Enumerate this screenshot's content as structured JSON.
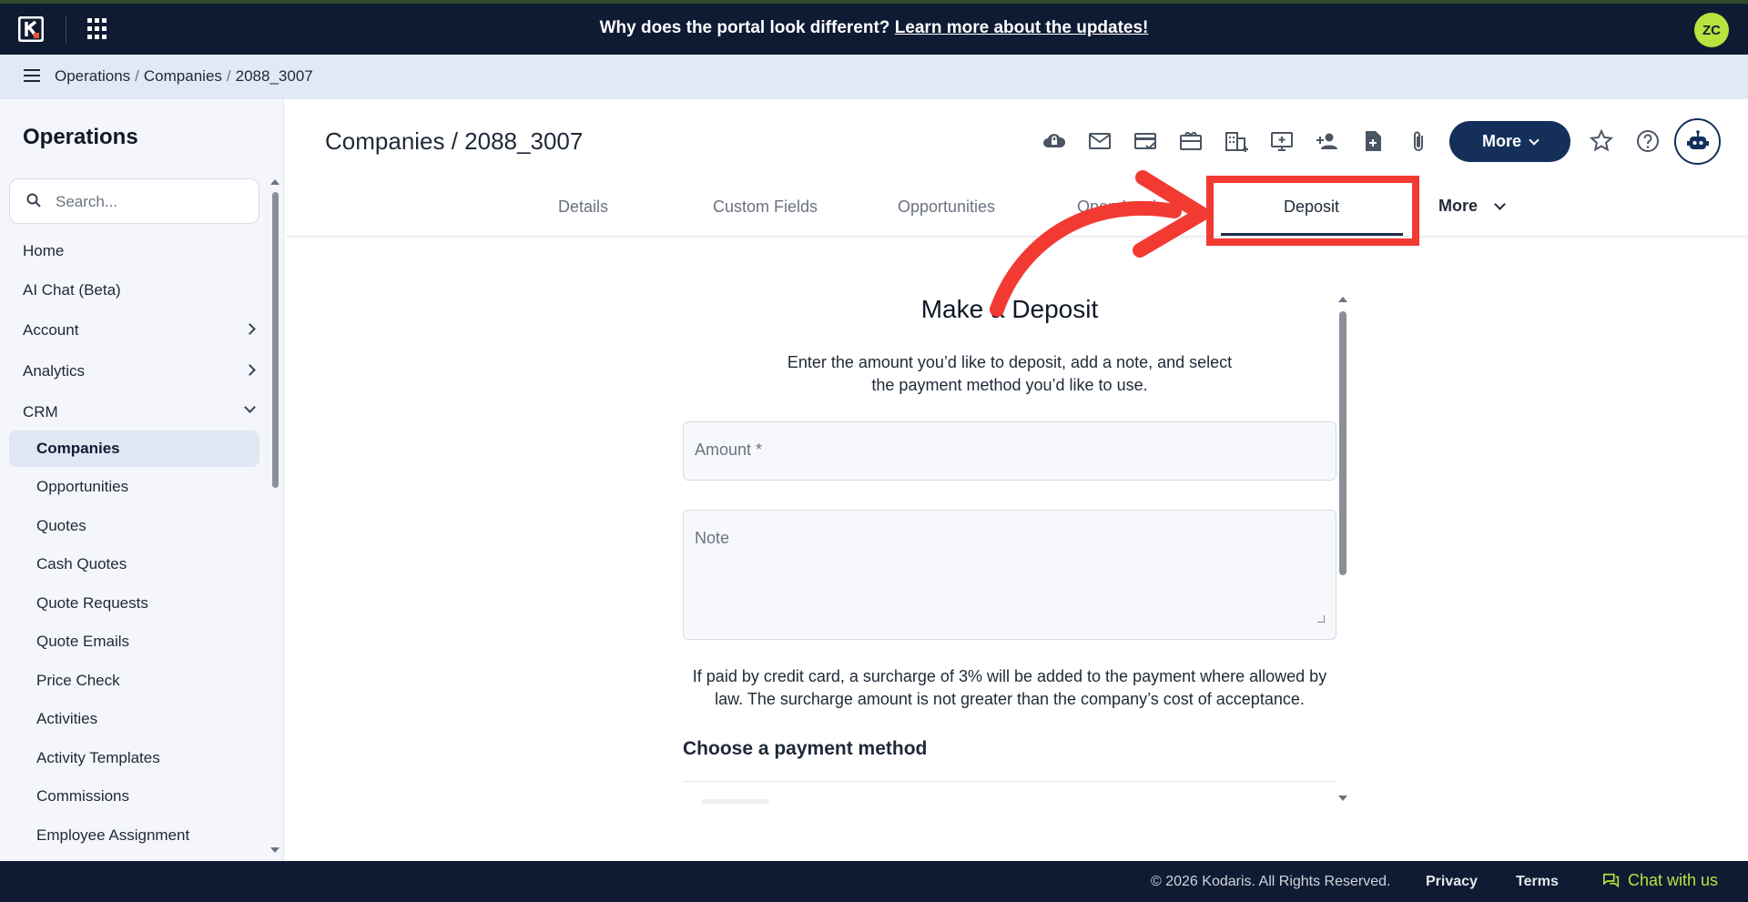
{
  "topbar": {
    "banner_text": "Why does the portal look different?",
    "banner_link": "Learn more about the updates!",
    "user_initials": "ZC"
  },
  "breadcrumb": {
    "items": [
      "Operations",
      "Companies",
      "2088_3007"
    ]
  },
  "sidebar": {
    "title": "Operations",
    "search_placeholder": "Search...",
    "items": [
      {
        "label": "Home"
      },
      {
        "label": "AI Chat (Beta)"
      },
      {
        "label": "Account"
      },
      {
        "label": "Analytics"
      },
      {
        "label": "CRM"
      }
    ],
    "crm_items": [
      {
        "label": "Companies"
      },
      {
        "label": "Opportunities"
      },
      {
        "label": "Quotes"
      },
      {
        "label": "Cash Quotes"
      },
      {
        "label": "Quote Requests"
      },
      {
        "label": "Quote Emails"
      },
      {
        "label": "Price Check"
      },
      {
        "label": "Activities"
      },
      {
        "label": "Activity Templates"
      },
      {
        "label": "Commissions"
      },
      {
        "label": "Employee Assignment"
      }
    ]
  },
  "header": {
    "title": "Companies / 2088_3007",
    "more_label": "More"
  },
  "tabs": {
    "items": [
      {
        "label": "Details"
      },
      {
        "label": "Custom Fields"
      },
      {
        "label": "Opportunities"
      },
      {
        "label": "Open Invoi"
      },
      {
        "label": "Deposit"
      }
    ],
    "more_label": "More"
  },
  "deposit": {
    "title": "Make a Deposit",
    "description": "Enter the amount you’d like to deposit, add a note, and select the payment method you’d like to use.",
    "amount_placeholder": "Amount *",
    "note_placeholder": "Note",
    "surcharge_text": "If paid by credit card, a surcharge of 3% will be added to the payment where allowed by law. The surcharge amount is not greater than the company’s cost of acceptance.",
    "choose_heading": "Choose a payment method"
  },
  "footer": {
    "copyright": "© 2026 Kodaris. All Rights Reserved.",
    "privacy": "Privacy",
    "terms": "Terms",
    "chat": "Chat with us"
  },
  "colors": {
    "navy": "#0f1b33",
    "accent": "#14305a",
    "lime": "#b9e23e",
    "annotation": "#f23a33"
  }
}
